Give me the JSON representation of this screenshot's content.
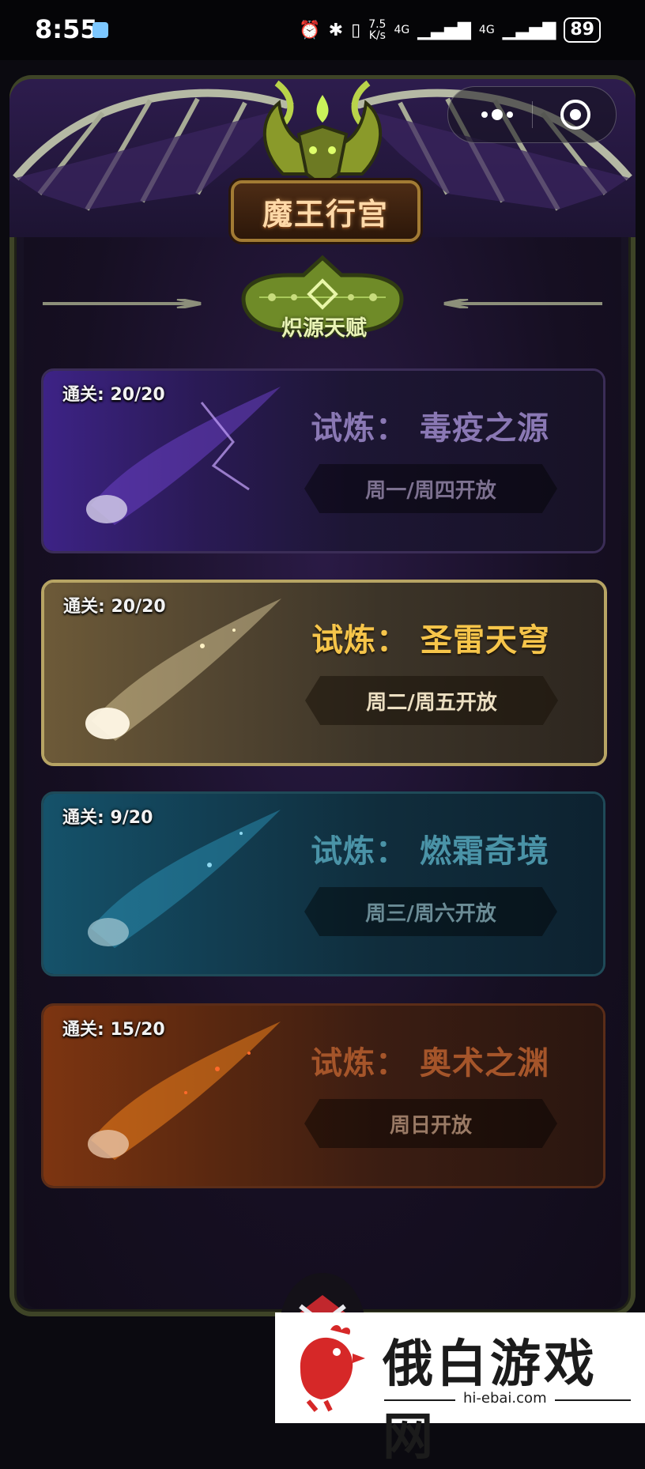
{
  "status_bar": {
    "time": "8:55",
    "network_speed": "7.5\nK/s",
    "signal_1": "4G",
    "signal_2": "4G",
    "battery": "89"
  },
  "header": {
    "title": "魔王行宫",
    "tab": "炽源天赋"
  },
  "trials": [
    {
      "clear_progress": "通关: 20/20",
      "name": "试炼：  毒疫之源",
      "schedule": "周一/周四开放",
      "theme": "purple",
      "color": "#8a78b4"
    },
    {
      "clear_progress": "通关: 20/20",
      "name": "试炼：  圣雷天穹",
      "schedule": "周二/周五开放",
      "theme": "gold",
      "color": "#f6c54a"
    },
    {
      "clear_progress": "通关: 9/20",
      "name": "试炼：  燃霜奇境",
      "schedule": "周三/周六开放",
      "theme": "blue",
      "color": "#4a93a7"
    },
    {
      "clear_progress": "通关: 15/20",
      "name": "试炼：  奥术之渊",
      "schedule": "周日开放",
      "theme": "orange",
      "color": "#a5552a"
    }
  ],
  "watermark": {
    "brand": "俄白游戏网",
    "url": "hi-ebai.com"
  },
  "icons": {
    "capsule_more": "more-dots-icon",
    "capsule_close": "mini-program-close-icon",
    "bottom": "crossed-weapons-emblem-icon"
  }
}
